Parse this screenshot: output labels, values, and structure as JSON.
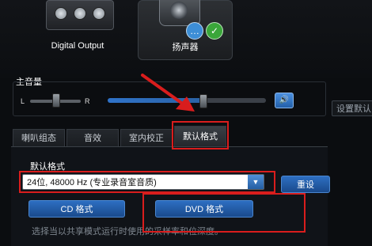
{
  "devices": {
    "digital_output": "Digital Output",
    "speaker": "扬声器"
  },
  "volume": {
    "title": "主音量",
    "left_label": "L",
    "right_label": "R",
    "balance_level": 0.5,
    "master_level": 0.6,
    "set_default": "设置默认"
  },
  "tabs": [
    {
      "label": "喇叭组态"
    },
    {
      "label": "音效"
    },
    {
      "label": "室内校正"
    },
    {
      "label": "默认格式"
    }
  ],
  "default_format": {
    "label": "默认格式",
    "selected": "24位, 48000 Hz (专业录音室音质)",
    "reset": "重设",
    "cd": "CD 格式",
    "dvd": "DVD 格式",
    "hint": "选择当以共享模式运行时使用的采样率和位深度。"
  },
  "colors": {
    "annotation": "#d91d1d",
    "accent": "#2e6fc2"
  }
}
